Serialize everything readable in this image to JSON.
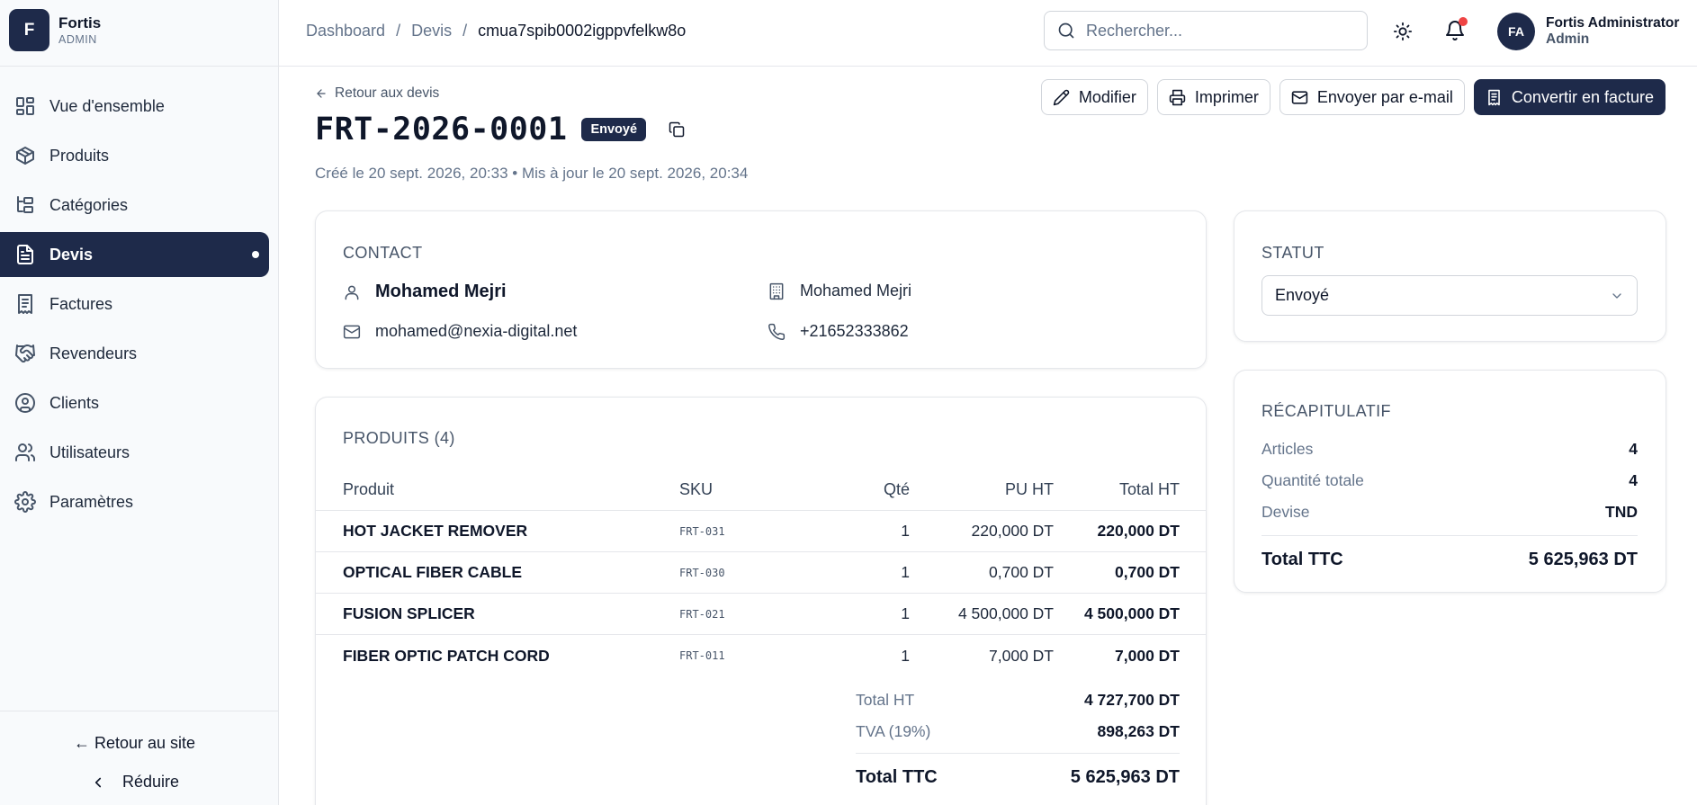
{
  "brand": {
    "logo_letter": "F",
    "name": "Fortis",
    "subtitle": "ADMIN"
  },
  "sidebar": {
    "items": [
      {
        "label": "Vue d'ensemble",
        "icon": "layout-dashboard-icon"
      },
      {
        "label": "Produits",
        "icon": "package-icon"
      },
      {
        "label": "Catégories",
        "icon": "folder-tree-icon"
      },
      {
        "label": "Devis",
        "icon": "file-text-icon",
        "active": true
      },
      {
        "label": "Factures",
        "icon": "receipt-icon"
      },
      {
        "label": "Revendeurs",
        "icon": "handshake-icon"
      },
      {
        "label": "Clients",
        "icon": "user-circle-icon"
      },
      {
        "label": "Utilisateurs",
        "icon": "users-icon"
      },
      {
        "label": "Paramètres",
        "icon": "settings-icon"
      }
    ],
    "back_to_site": "← Retour au site",
    "collapse_label": "Réduire"
  },
  "topbar": {
    "breadcrumb": [
      "Dashboard",
      "Devis",
      "cmua7spib0002igppvfelkw8o"
    ],
    "separator": "/",
    "search_placeholder": "Rechercher...",
    "user": {
      "initials": "FA",
      "name": "Fortis Administrator",
      "role": "Admin"
    }
  },
  "page": {
    "back_link": "Retour aux devis",
    "title": "FRT-2026-0001",
    "status_badge": "Envoyé",
    "meta": "Créé le 20 sept. 2026, 20:33 • Mis à jour le 20 sept. 2026, 20:34",
    "actions": {
      "edit": "Modifier",
      "print": "Imprimer",
      "email": "Envoyer par e-mail",
      "convert": "Convertir en facture"
    }
  },
  "contact": {
    "title": "CONTACT",
    "name": "Mohamed Mejri",
    "company": "Mohamed Mejri",
    "email": "mohamed@nexia-digital.net",
    "phone": "+21652333862"
  },
  "products": {
    "title": "PRODUITS (4)",
    "columns": {
      "name": "Produit",
      "sku": "SKU",
      "qty": "Qté",
      "unit": "PU HT",
      "total": "Total HT"
    },
    "rows": [
      {
        "name": "HOT JACKET REMOVER",
        "sku": "FRT-031",
        "qty": "1",
        "unit": "220,000 DT",
        "total": "220,000 DT"
      },
      {
        "name": "OPTICAL FIBER CABLE",
        "sku": "FRT-030",
        "qty": "1",
        "unit": "0,700 DT",
        "total": "0,700 DT"
      },
      {
        "name": "FUSION SPLICER",
        "sku": "FRT-021",
        "qty": "1",
        "unit": "4 500,000 DT",
        "total": "4 500,000 DT"
      },
      {
        "name": "FIBER OPTIC PATCH CORD",
        "sku": "FRT-011",
        "qty": "1",
        "unit": "7,000 DT",
        "total": "7,000 DT"
      }
    ],
    "totals": {
      "ht_label": "Total HT",
      "ht": "4 727,700 DT",
      "tva_label": "TVA (19%)",
      "tva": "898,263 DT",
      "ttc_label": "Total TTC",
      "ttc": "5 625,963 DT"
    }
  },
  "status": {
    "title": "STATUT",
    "selected": "Envoyé"
  },
  "summary": {
    "title": "RÉCAPITULATIF",
    "articles_label": "Articles",
    "articles": "4",
    "qty_label": "Quantité totale",
    "qty": "4",
    "currency_label": "Devise",
    "currency": "TND",
    "ttc_label": "Total TTC",
    "ttc": "5 625,963 DT"
  },
  "colors": {
    "primary": "#1e2a4a",
    "notification": "#ef4444",
    "muted": "#64748b"
  }
}
